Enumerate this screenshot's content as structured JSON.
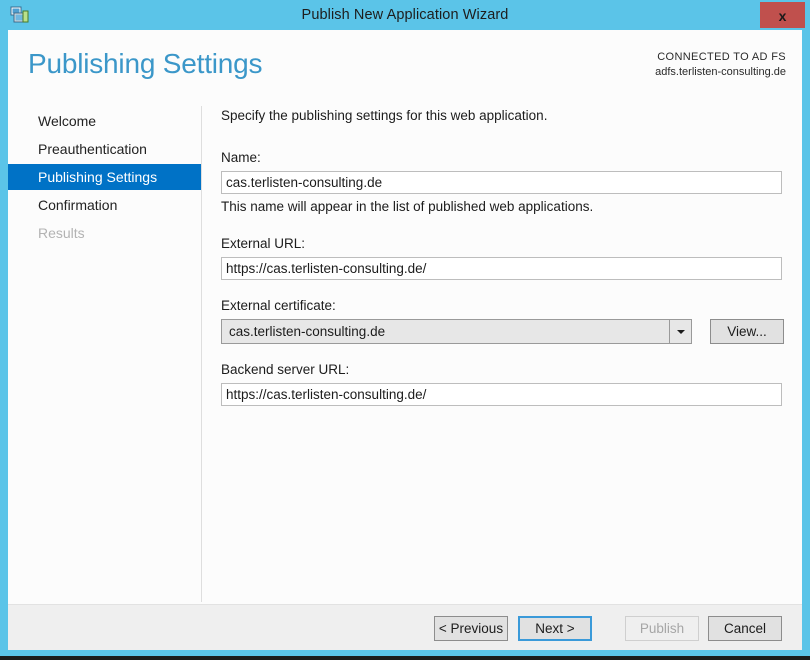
{
  "window": {
    "title": "Publish New Application Wizard",
    "icon": "application-publish-icon",
    "close_label": "x",
    "frame_color": "#5bc4e8",
    "close_color": "#c0504d"
  },
  "header": {
    "page_title": "Publishing Settings",
    "title_color": "#3b97c9",
    "connected_label": "CONNECTED TO AD FS",
    "connected_value": "adfs.terlisten-consulting.de"
  },
  "sidebar": {
    "items": [
      {
        "label": "Welcome",
        "state": "normal"
      },
      {
        "label": "Preauthentication",
        "state": "normal"
      },
      {
        "label": "Publishing Settings",
        "state": "selected"
      },
      {
        "label": "Confirmation",
        "state": "normal"
      },
      {
        "label": "Results",
        "state": "disabled"
      }
    ],
    "selected_color": "#0072c6"
  },
  "main": {
    "intro": "Specify the publishing settings for this web application.",
    "name_field": {
      "label": "Name:",
      "value": "cas.terlisten-consulting.de",
      "placeholder": "",
      "hint": "This name will appear in the list of published web applications."
    },
    "external_url_field": {
      "label": "External URL:",
      "value": "https://cas.terlisten-consulting.de/",
      "placeholder": ""
    },
    "external_certificate_field": {
      "label": "External certificate:",
      "value": "cas.terlisten-consulting.de",
      "dropdown_icon": "chevron-down-icon",
      "view_button_label": "View..."
    },
    "backend_url_field": {
      "label": "Backend server URL:",
      "value": "https://cas.terlisten-consulting.de/",
      "placeholder": ""
    }
  },
  "footer": {
    "previous_label": "< Previous",
    "next_label": "Next >",
    "publish_label": "Publish",
    "cancel_label": "Cancel",
    "default_button_accent": "#3a9ad9"
  }
}
